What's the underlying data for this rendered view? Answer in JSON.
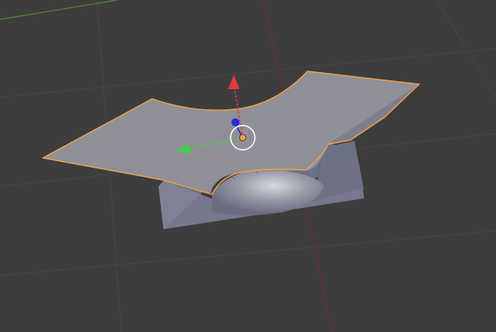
{
  "app": "3D viewport",
  "viewport": {
    "background_color": "#3d3d3d",
    "grid_line_color": "#4a4a4a",
    "x_axis_color": "#c8363a",
    "y_axis_color": "#5fa82f",
    "selection_outline_color": "#f0a04b"
  },
  "mesh": {
    "state": "selected",
    "top_face_color": "#8f9097",
    "inner_face_color": "#6f7387",
    "side_face_color": "#7b7e91"
  },
  "transform_gizmo": {
    "icon": "transform-gizmo-icon",
    "x_arrow_color": "#e13b3b",
    "y_arrow_color": "#3fd43f",
    "z_handle_color": "#2b2bd9",
    "origin_color": "#f0a04b",
    "ring_color": "#ffffff"
  }
}
